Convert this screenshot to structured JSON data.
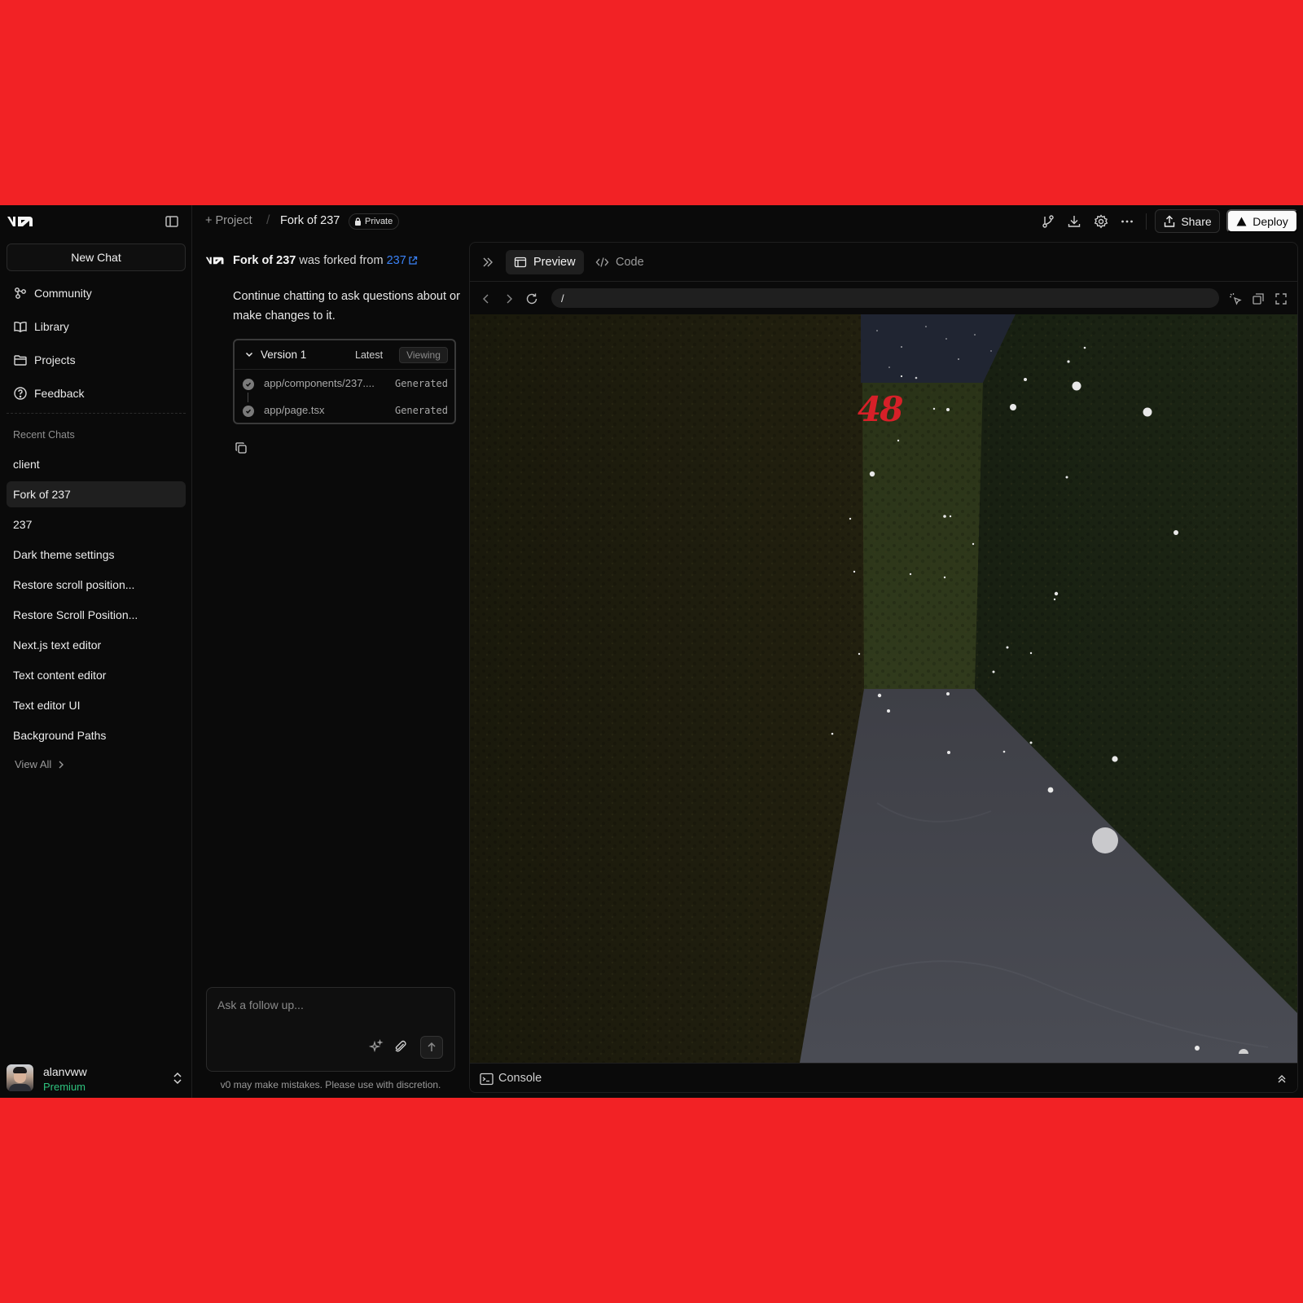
{
  "sidebar": {
    "logo_icon": "v0-logo",
    "new_chat_label": "New Chat",
    "nav": [
      {
        "label": "Community",
        "icon": "community-icon"
      },
      {
        "label": "Library",
        "icon": "book-icon"
      },
      {
        "label": "Projects",
        "icon": "folder-icon"
      },
      {
        "label": "Feedback",
        "icon": "help-circle-icon"
      }
    ],
    "recent_title": "Recent Chats",
    "recent": [
      "client",
      "Fork of 237",
      "237",
      "Dark theme settings",
      "Restore scroll position...",
      "Restore Scroll Position...",
      "Next.js text editor",
      "Text content editor",
      "Text editor UI",
      "Background Paths"
    ],
    "active_recent": "Fork of 237",
    "view_all_label": "View All",
    "user": {
      "name": "alanvww",
      "plan": "Premium"
    }
  },
  "topbar": {
    "project_label": "+ Project",
    "separator": "/",
    "chat_title": "Fork of 237",
    "visibility": "Private",
    "share_label": "Share",
    "deploy_label": "Deploy"
  },
  "chat": {
    "fork_title": "Fork of 237",
    "fork_text": " was forked from ",
    "fork_source": "237",
    "intro": "Continue chatting to ask questions about or make changes to it.",
    "version": {
      "title": "Version 1",
      "latest_label": "Latest",
      "viewing_label": "Viewing",
      "files": [
        {
          "name": "app/components/237....",
          "status": "Generated"
        },
        {
          "name": "app/page.tsx",
          "status": "Generated"
        }
      ]
    },
    "composer_placeholder": "Ask a follow up...",
    "disclaimer": "v0 may make mistakes. Please use with discretion."
  },
  "preview": {
    "tabs": [
      {
        "label": "Preview",
        "icon": "browser-icon",
        "active": true
      },
      {
        "label": "Code",
        "icon": "code-icon",
        "active": false
      }
    ],
    "url": "/",
    "game_score": "48",
    "console_label": "Console"
  },
  "colors": {
    "background_frame": "#f22225",
    "app_bg": "#0a0a0a",
    "link_blue": "#3b82f6",
    "premium_green": "#2ec27e",
    "score_red": "#d62028"
  }
}
